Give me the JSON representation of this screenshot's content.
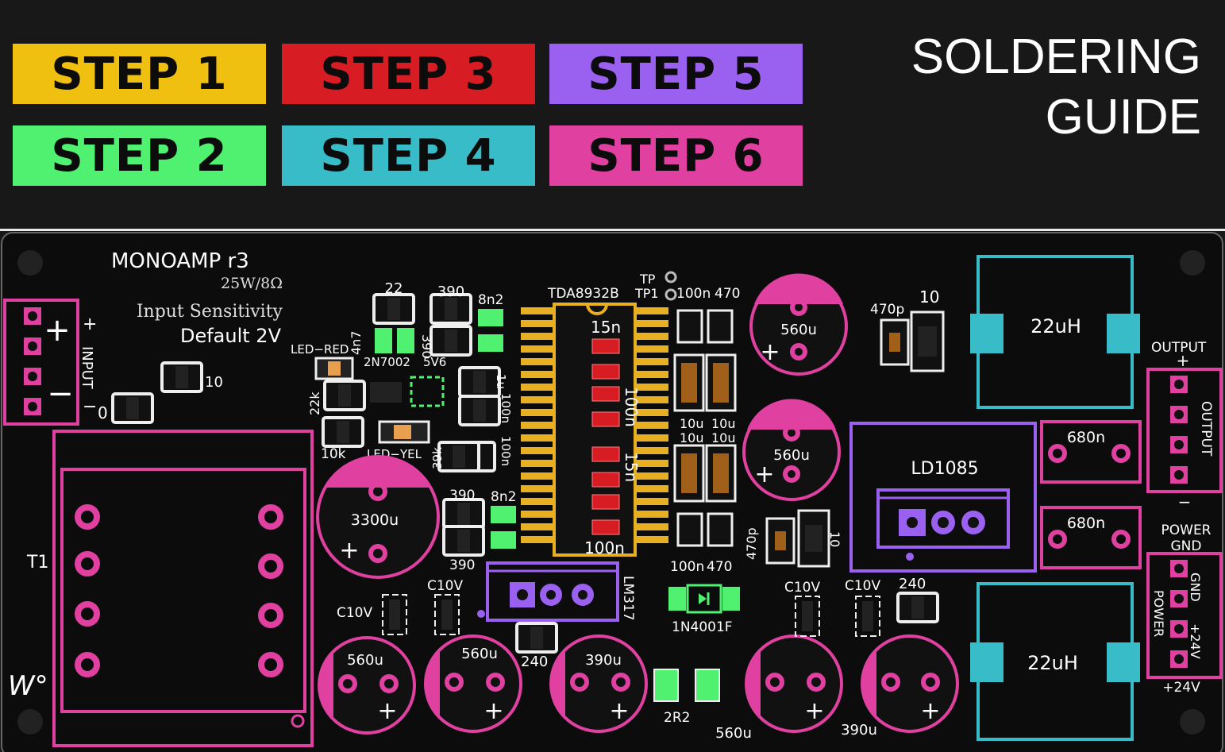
{
  "header": {
    "title_line1": "SOLDERING",
    "title_line2": "GUIDE",
    "steps": [
      {
        "label": "STEP 1",
        "color": "#f0c010"
      },
      {
        "label": "STEP 2",
        "color": "#50f070"
      },
      {
        "label": "STEP 3",
        "color": "#d81c24"
      },
      {
        "label": "STEP 4",
        "color": "#38bcc8"
      },
      {
        "label": "STEP 5",
        "color": "#9a60f0"
      },
      {
        "label": "STEP 6",
        "color": "#e040a0"
      }
    ]
  },
  "board": {
    "name": "MONOAMP r3",
    "rating": "25W/8Ω",
    "sensitivity_label": "Input Sensitivity",
    "sensitivity_value": "Default 2V",
    "logo": "W°",
    "input": {
      "label": "INPUT",
      "plus": "+",
      "minus": "−",
      "plus_small": "+",
      "minus_small": "−"
    },
    "output": {
      "label": "OUTPUT",
      "top": "OUTPUT",
      "plus": "+",
      "minus": "−"
    },
    "power": {
      "label": "POWER",
      "top": "POWER",
      "gnd": "GND",
      "v24": "+24V",
      "bottom": "+24V"
    },
    "transformer": "T1",
    "ic": {
      "name": "TDA8932B",
      "c1": "15n",
      "c2": "100n",
      "c3": "15n",
      "c4": "100n"
    },
    "tp": {
      "tp": "TP",
      "tp1": "TP1"
    },
    "regulator": "LD1085",
    "lm317": "LM317",
    "diode": "1N4001F",
    "resistor_2r2": "2R2",
    "leds": {
      "red": "LED−RED",
      "yellow": "LED−YEL"
    },
    "small": {
      "r22": "22",
      "r390a": "390",
      "c8n2a": "8n2",
      "r390b": "390",
      "c4n7": "4n7",
      "q2n7002": "2N7002",
      "z5v6": "5V6",
      "r22k": "22k",
      "r10k": "10k",
      "c1u": "1u",
      "c100n_a": "100n",
      "c100n_b": "100n",
      "r39k": "39k",
      "r390c": "390",
      "c8n2b": "8n2",
      "r390d": "390",
      "r10": "10",
      "r0": "0",
      "c100n_c": "100n",
      "r470a": "470",
      "c10u_a": "10u",
      "c10u_b": "10u",
      "c10u_c": "10u",
      "c10u_d": "10u",
      "c100n_d": "100n",
      "r470b": "470",
      "c470p_a": "470p",
      "r10b": "10",
      "c470p_b": "470p",
      "r10c": "10",
      "c10v_a": "C10V",
      "c10v_b": "C10V",
      "c10v_c": "C10V",
      "c10v_d": "C10V",
      "r240a": "240",
      "r240b": "240"
    },
    "caps": {
      "c3300u": "3300u",
      "c560u_a": "560u",
      "c560u_b": "560u",
      "c560u_c": "560u",
      "c560u_d": "560u",
      "c390u_a": "390u",
      "c560u_e": "560u",
      "c390u_b": "390u",
      "plus": "+"
    },
    "inductors": {
      "l1": "22uH",
      "l2": "22uH",
      "c680n_a": "680n",
      "c680n_b": "680n"
    }
  }
}
